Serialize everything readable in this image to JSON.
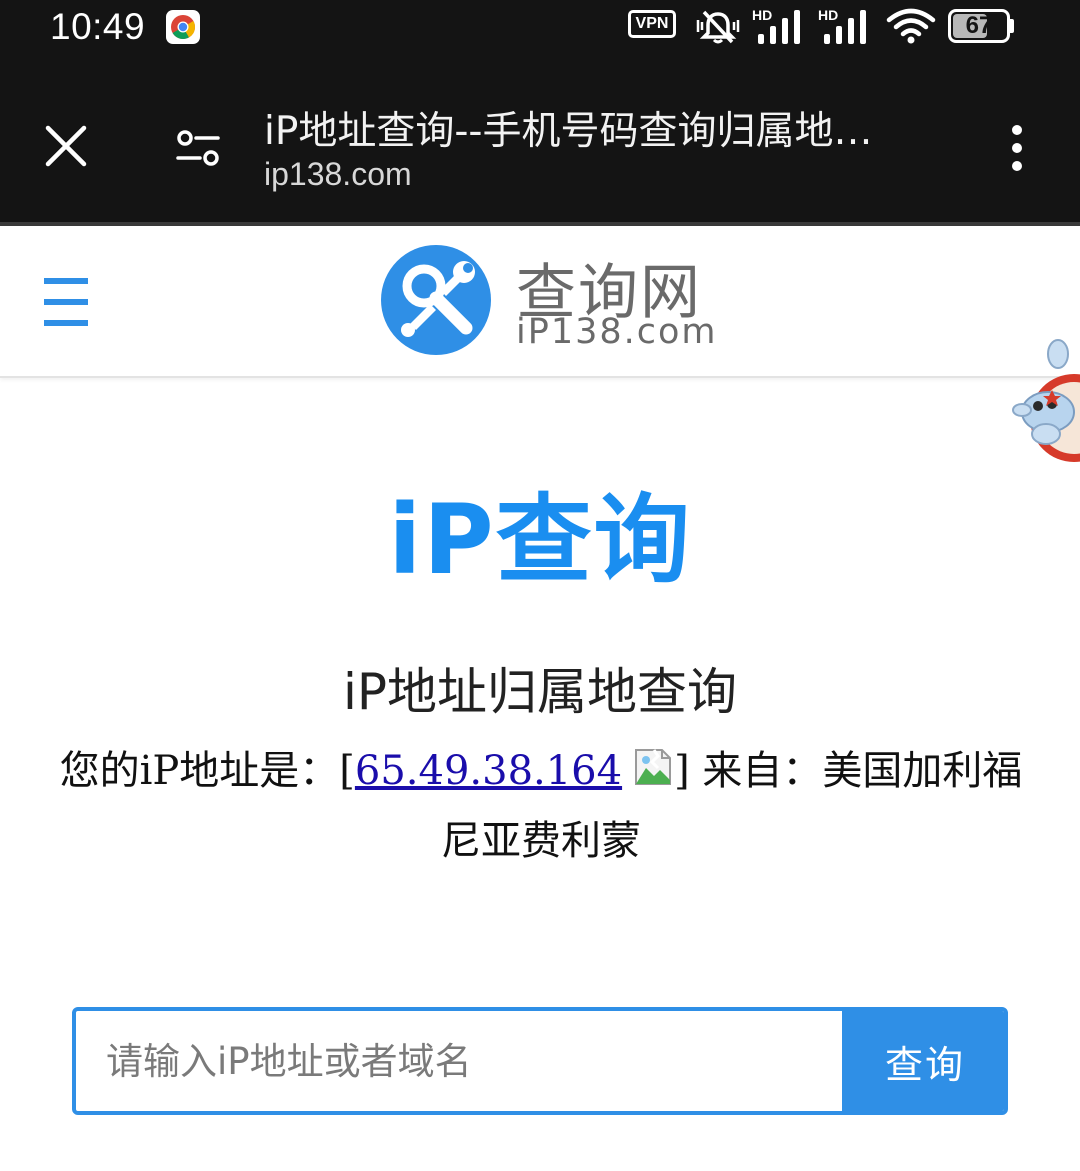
{
  "status_bar": {
    "time": "10:49",
    "vpn_label": "VPN",
    "signal_badge_1": "HD",
    "signal_badge_2": "HD",
    "battery_level": "67"
  },
  "toolbar": {
    "title": "iP地址查询--手机号码查询归属地…",
    "url": "ip138.com"
  },
  "header": {
    "logo_name": "查询网",
    "logo_domain": "iP138.com"
  },
  "main": {
    "hero_title": "iP查询",
    "subtitle": "iP地址归属地查询",
    "ip_prefix": "您的iP地址是：[",
    "ip_address": "65.49.38.164",
    "ip_suffix": "] 来自：",
    "location": "美国加利福尼亚费利蒙"
  },
  "search": {
    "placeholder": "请输入iP地址或者域名",
    "button_label": "查询"
  },
  "colors": {
    "brand_blue": "#2f8fe6",
    "hero_blue": "#1a8ef0",
    "bar_dark": "#141414",
    "link": "#1a0dab"
  },
  "icons": [
    "chrome-icon",
    "mute-icon",
    "signal-icon",
    "wifi-icon",
    "battery-icon",
    "close-icon",
    "site-settings-icon",
    "more-vert-icon",
    "hamburger-icon",
    "logo-tools-icon",
    "broken-image-icon",
    "mascot-icon"
  ]
}
